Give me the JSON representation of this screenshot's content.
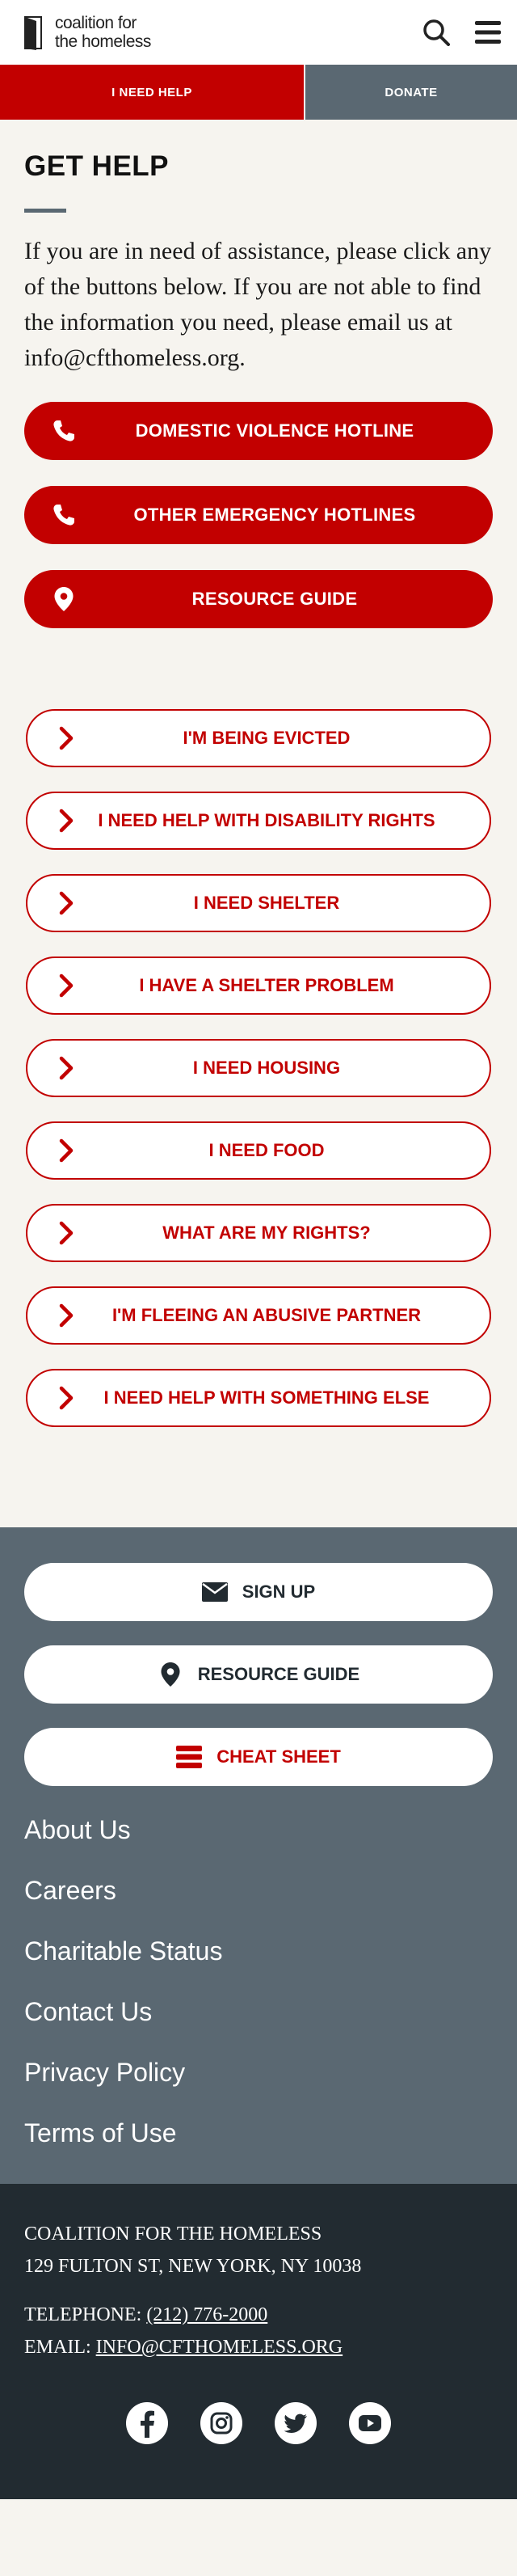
{
  "header": {
    "logo_line1": "coalition for",
    "logo_line2": "the homeless",
    "search_icon": "search-icon",
    "menu_icon": "hamburger-menu-icon"
  },
  "topbar": {
    "help_label": "I NEED HELP",
    "donate_label": "DONATE",
    "help_color": "#c20000",
    "donate_color": "#5a6872"
  },
  "main": {
    "title": "GET HELP",
    "intro": "If you are in need of assistance, please click any of the buttons below. If you are not able to find the information you need, please email us at info@cfthomeless.org.",
    "primary_buttons": [
      {
        "label": "DOMESTIC VIOLENCE HOTLINE",
        "icon": "phone-icon"
      },
      {
        "label": "OTHER EMERGENCY HOTLINES",
        "icon": "phone-icon"
      },
      {
        "label": "RESOURCE GUIDE",
        "icon": "map-pin-icon"
      }
    ],
    "help_topics": [
      "I'M BEING EVICTED",
      "I NEED HELP WITH DISABILITY RIGHTS",
      "I NEED SHELTER",
      "I HAVE A SHELTER PROBLEM",
      "I NEED HOUSING",
      "I NEED FOOD",
      "WHAT ARE MY RIGHTS?",
      "I'M FLEEING AN ABUSIVE PARTNER",
      "I NEED HELP WITH SOMETHING ELSE"
    ],
    "accent_color": "#c20000"
  },
  "footer_nav": {
    "buttons": [
      {
        "label": "SIGN UP",
        "icon": "envelope-icon"
      },
      {
        "label": "RESOURCE GUIDE",
        "icon": "map-pin-icon"
      },
      {
        "label": "CHEAT SHEET",
        "icon": "list-icon"
      }
    ],
    "links": [
      "About Us",
      "Careers",
      "Charitable Status",
      "Contact Us",
      "Privacy Policy",
      "Terms of Use"
    ],
    "background": "#5a6872"
  },
  "bottom": {
    "org_name": "COALITION FOR THE HOMELESS",
    "address": "129 FULTON ST, NEW YORK, NY 10038",
    "telephone_label": "TELEPHONE:",
    "telephone": "(212) 776-2000",
    "email_label": "EMAIL:",
    "email": "INFO@CFTHOMELESS.ORG",
    "social": [
      "facebook-icon",
      "instagram-icon",
      "twitter-icon",
      "youtube-icon"
    ],
    "background": "#222b31"
  }
}
